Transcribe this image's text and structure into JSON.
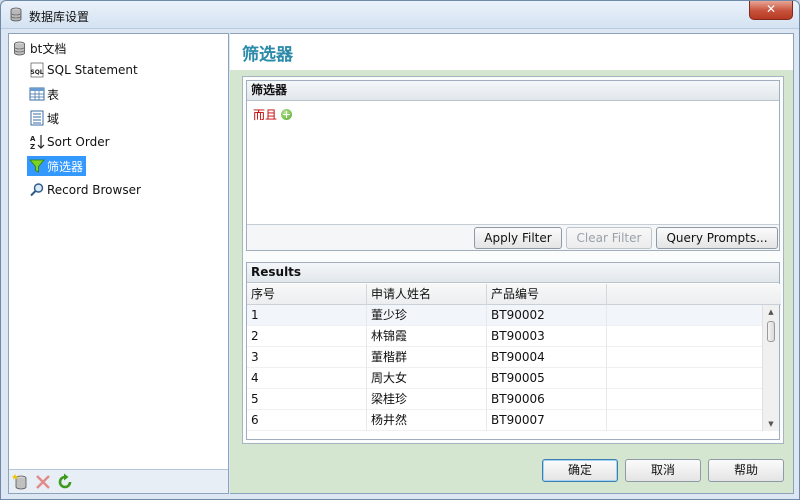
{
  "window": {
    "title": "数据库设置",
    "close_label": "✕",
    "title_icon": "database-icon"
  },
  "tree": {
    "root": {
      "label": "bt文档",
      "icon": "database-icon"
    },
    "items": [
      {
        "label": "SQL Statement",
        "icon": "sql-icon"
      },
      {
        "label": "表",
        "icon": "table-icon"
      },
      {
        "label": "域",
        "icon": "fields-icon"
      },
      {
        "label": "Sort Order",
        "icon": "sort-az-icon"
      },
      {
        "label": "筛选器",
        "icon": "filter-funnel-icon",
        "selected": true
      },
      {
        "label": "Record Browser",
        "icon": "search-icon"
      }
    ],
    "toolbar": [
      "add-database-icon",
      "delete-icon",
      "refresh-icon"
    ]
  },
  "page": {
    "title": "筛选器"
  },
  "filter_group": {
    "header": "筛选器",
    "and_label": "而且",
    "apply_button": "Apply Filter",
    "clear_button": "Clear Filter",
    "prompts_button": "Query Prompts..."
  },
  "results": {
    "header": "Results",
    "columns": [
      "序号",
      "申请人姓名",
      "产品编号",
      ""
    ],
    "rows": [
      [
        "1",
        "董少珍",
        "BT90002",
        ""
      ],
      [
        "2",
        "林锦霞",
        "BT90003",
        ""
      ],
      [
        "3",
        "董楷群",
        "BT90004",
        ""
      ],
      [
        "4",
        "周大女",
        "BT90005",
        ""
      ],
      [
        "5",
        "梁桂珍",
        "BT90006",
        ""
      ],
      [
        "6",
        "杨井然",
        "BT90007",
        ""
      ]
    ]
  },
  "dialog": {
    "ok": "确定",
    "cancel": "取消",
    "help": "帮助"
  },
  "colors": {
    "accent_title": "#2a8aa8",
    "selected_bg": "#3399ff",
    "and_red": "#c00000",
    "panel_green": "#d4e6cf"
  }
}
